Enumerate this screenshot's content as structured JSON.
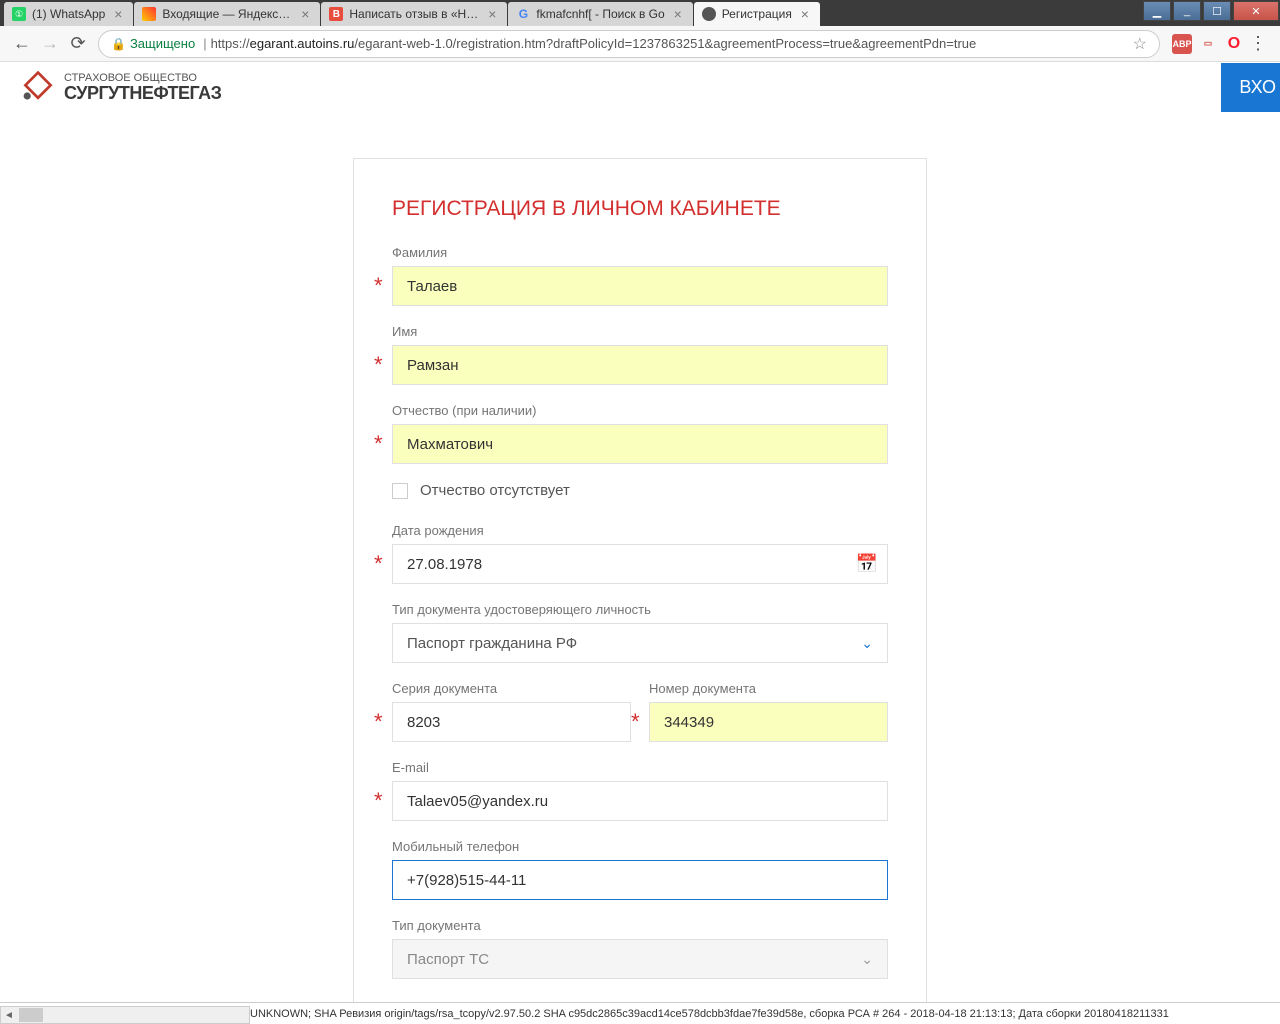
{
  "window": {
    "tabs": [
      {
        "title": "(1) WhatsApp"
      },
      {
        "title": "Входящие — Яндекс.По"
      },
      {
        "title": "Написать отзыв в «Наро"
      },
      {
        "title": "fkmafcnhf[ - Поиск в Go"
      },
      {
        "title": "Регистрация"
      }
    ]
  },
  "addr": {
    "secure_label": "Защищено",
    "url_prefix": "https://",
    "url_host": "egarant.autoins.ru",
    "url_path": "/egarant-web-1.0/registration.htm?draftPolicyId=1237863251&agreementProcess=true&agreementPdn=true"
  },
  "header": {
    "logo_top": "СТРАХОВОЕ ОБЩЕСТВО",
    "logo_main": "СУРГУТНЕФТЕГАЗ",
    "login": "ВХО"
  },
  "form": {
    "title": "РЕГИСТРАЦИЯ В ЛИЧНОМ КАБИНЕТЕ",
    "surname_label": "Фамилия",
    "surname_value": "Талаев",
    "name_label": "Имя",
    "name_value": "Рамзан",
    "patronymic_label": "Отчество (при наличии)",
    "patronymic_value": "Махматович",
    "no_patronymic": "Отчество отсутствует",
    "dob_label": "Дата рождения",
    "dob_value": "27.08.1978",
    "doctype_label": "Тип документа удостоверяющего личность",
    "doctype_value": "Паспорт гражданина РФ",
    "series_label": "Серия документа",
    "series_value": "8203",
    "number_label": "Номер документа",
    "number_value": "344349",
    "email_label": "E-mail",
    "email_value": "Talaev05@yandex.ru",
    "phone_label": "Мобильный телефон",
    "phone_value": "+7(928)515-44-11",
    "doctype2_label": "Тип документа",
    "doctype2_value": "Паспорт ТС"
  },
  "status": "UNKNOWN; SHA Ревизия origin/tags/rsa_tcopy/v2.97.50.2 SHA c95dc2865c39acd14ce578dcbb3fdae7fe39d58e, сборка РСА # 264 - 2018-04-18 21:13:13; Дата сборки 20180418211331"
}
